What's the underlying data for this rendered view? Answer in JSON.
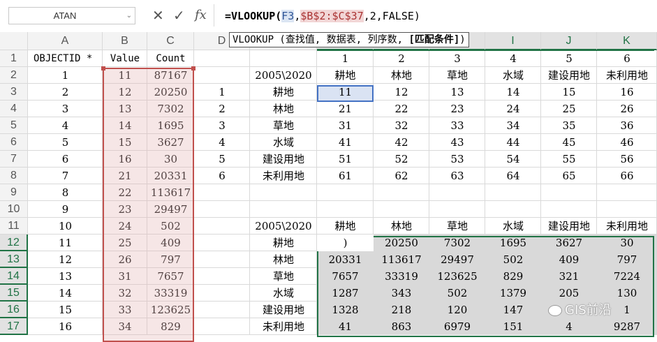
{
  "name_box": {
    "value": "ATAN",
    "arrow": "⌄"
  },
  "formula_bar": {
    "cancel": "✕",
    "enter": "✓",
    "fx": "fx",
    "formula_pre": "=VLOOKUP(",
    "ref1": "F3",
    "sep1": ",",
    "ref2": "$B$2:$C$37",
    "formula_post": ",2,FALSE)"
  },
  "tooltip": {
    "text": "VLOOKUP (查找值, 数据表, 列序数, ",
    "bold": "[匹配条件]",
    "end": ")"
  },
  "columns": [
    "A",
    "B",
    "C",
    "D",
    "E",
    "F",
    "G",
    "H",
    "I",
    "J",
    "K"
  ],
  "rows": [
    "1",
    "2",
    "3",
    "4",
    "5",
    "6",
    "7",
    "8",
    "9",
    "10",
    "11",
    "12",
    "13",
    "14",
    "15",
    "16",
    "17"
  ],
  "headers_row1": {
    "A": "OBJECTID *",
    "B": "Value",
    "C": "Count",
    "F": "1",
    "G": "2",
    "H": "3",
    "I": "4",
    "J": "5",
    "K": "6"
  },
  "col_a": [
    "1",
    "2",
    "3",
    "4",
    "5",
    "6",
    "7",
    "8",
    "9",
    "10",
    "11",
    "12",
    "13",
    "14",
    "15",
    "16"
  ],
  "col_b": [
    "11",
    "12",
    "13",
    "14",
    "15",
    "16",
    "21",
    "22",
    "23",
    "24",
    "25",
    "26",
    "31",
    "32",
    "33",
    "34"
  ],
  "col_c": [
    "87167",
    "20250",
    "7302",
    "1695",
    "3627",
    "30",
    "20331",
    "113617",
    "29497",
    "502",
    "409",
    "797",
    "7657",
    "33319",
    "123625",
    "829"
  ],
  "col_d": [
    "1",
    "2",
    "3",
    "4",
    "5",
    "6"
  ],
  "table1": {
    "corner": "2005\\2020",
    "col_labels": [
      "耕地",
      "林地",
      "草地",
      "水域",
      "建设用地",
      "未利用地"
    ],
    "row_labels": [
      "耕地",
      "林地",
      "草地",
      "水域",
      "建设用地",
      "未利用地"
    ],
    "cells": [
      [
        "11",
        "12",
        "13",
        "14",
        "15",
        "16"
      ],
      [
        "21",
        "22",
        "23",
        "24",
        "25",
        "26"
      ],
      [
        "31",
        "32",
        "33",
        "34",
        "35",
        "36"
      ],
      [
        "41",
        "42",
        "43",
        "44",
        "45",
        "46"
      ],
      [
        "51",
        "52",
        "53",
        "54",
        "55",
        "56"
      ],
      [
        "61",
        "62",
        "63",
        "64",
        "65",
        "66"
      ]
    ]
  },
  "table2": {
    "corner": "2005\\2020",
    "col_labels": [
      "耕地",
      "林地",
      "草地",
      "水域",
      "建设用地",
      "未利用地"
    ],
    "row_labels": [
      "耕地",
      "林地",
      "草地",
      "水域",
      "建设用地",
      "未利用地"
    ],
    "cells": [
      [
        ")",
        "20250",
        "7302",
        "1695",
        "3627",
        "30"
      ],
      [
        "20331",
        "113617",
        "29497",
        "502",
        "409",
        "797"
      ],
      [
        "7657",
        "33319",
        "123625",
        "829",
        "321",
        "7224"
      ],
      [
        "1287",
        "343",
        "502",
        "1379",
        "205",
        "130"
      ],
      [
        "1328",
        "218",
        "120",
        "147",
        "",
        "1"
      ],
      [
        "41",
        "863",
        "6979",
        "151",
        "4",
        "9287"
      ]
    ]
  },
  "watermark": "GIS前沿",
  "colors": {
    "accent": "#217346",
    "ref_blue": "#4472c4",
    "ref_red": "#c0504d"
  }
}
